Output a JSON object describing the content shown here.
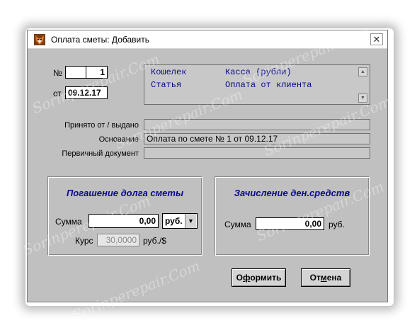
{
  "window": {
    "title": "Оплата сметы: Добавить",
    "close_glyph": "✕"
  },
  "doc": {
    "number_label": "№",
    "number_value": "1",
    "date_label": "от",
    "date_value": "09.12.17"
  },
  "info_panel": {
    "rows": [
      {
        "key": "Кошелек",
        "value": "Касса (рубли)"
      },
      {
        "key": "Статья",
        "value": "Оплата от клиента"
      }
    ]
  },
  "fields": {
    "received_label": "Принято от / выдано",
    "received_value": "",
    "basis_label": "Основание",
    "basis_value": "Оплата по смете № 1 от 09.12.17",
    "primary_doc_label": "Первичный документ",
    "primary_doc_value": ""
  },
  "debt_group": {
    "title": "Погашение долга сметы",
    "sum_label": "Сумма",
    "sum_value": "0,00",
    "currency_value": "руб.",
    "rate_label": "Курс",
    "rate_value": "30,0000",
    "rate_unit": "руб./$"
  },
  "credit_group": {
    "title": "Зачисление ден.средств",
    "sum_label": "Сумма",
    "sum_value": "0,00",
    "sum_unit": "руб."
  },
  "buttons": {
    "submit_label_pre": "О",
    "submit_label_u": "ф",
    "submit_label_post": "ормить",
    "cancel_label_pre": "От",
    "cancel_label_u": "м",
    "cancel_label_post": "ена"
  },
  "watermark": {
    "text": "Sorinperepair.Com"
  },
  "icons": {
    "app": "fox-head-icon",
    "close": "close-icon",
    "scroll_up": "scroll-up-icon",
    "scroll_down": "scroll-down-icon",
    "dropdown": "chevron-down-icon"
  },
  "colors": {
    "dialog_bg": "#c0c0c0",
    "accent_text": "#0a0a8a"
  }
}
